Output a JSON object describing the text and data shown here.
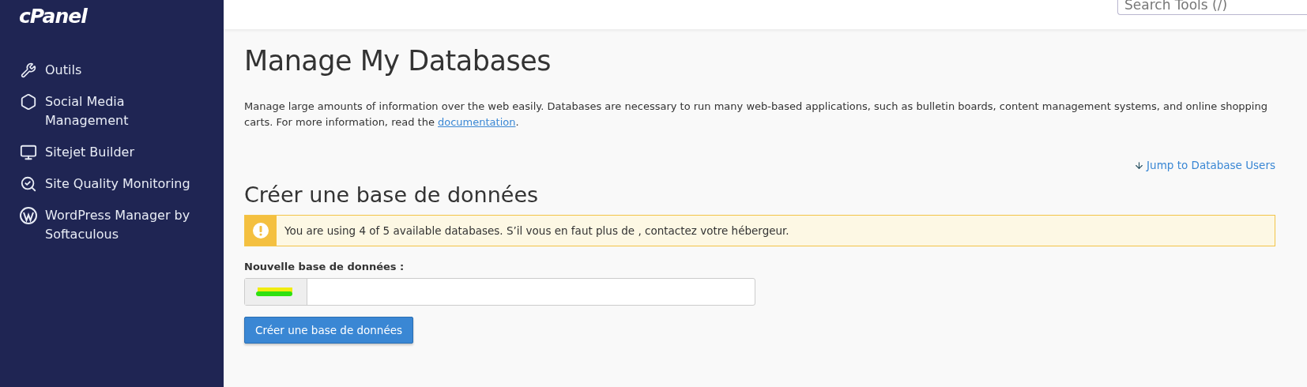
{
  "sidebar": {
    "logo": "cPanel",
    "items": [
      {
        "kind": "tools",
        "label": "Outils"
      },
      {
        "kind": "social",
        "label": "Social Media Management"
      },
      {
        "kind": "sitejet",
        "label": "Sitejet Builder"
      },
      {
        "kind": "quality",
        "label": "Site Quality Monitoring"
      },
      {
        "kind": "wordpress",
        "label": "WordPress Manager by Softaculous"
      }
    ]
  },
  "header": {
    "search": {
      "placeholder": "Search Tools (/)"
    }
  },
  "page": {
    "title": "Manage My Databases",
    "description": "Manage large amounts of information over the web easily. Databases are necessary to run many web-based applications, such as bulletin boards, content management systems, and online shopping carts. For more information, read the ",
    "description_link": "documentation",
    "description_end": ".",
    "jump_link": "Jump to Database Users",
    "section_title": "Créer une base de données",
    "alert": "You are using 4 of 5 available databases. S’il vous en faut plus de , contactez votre hébergeur.",
    "field_label": "Nouvelle base de données :",
    "button": "Créer une base de données"
  }
}
